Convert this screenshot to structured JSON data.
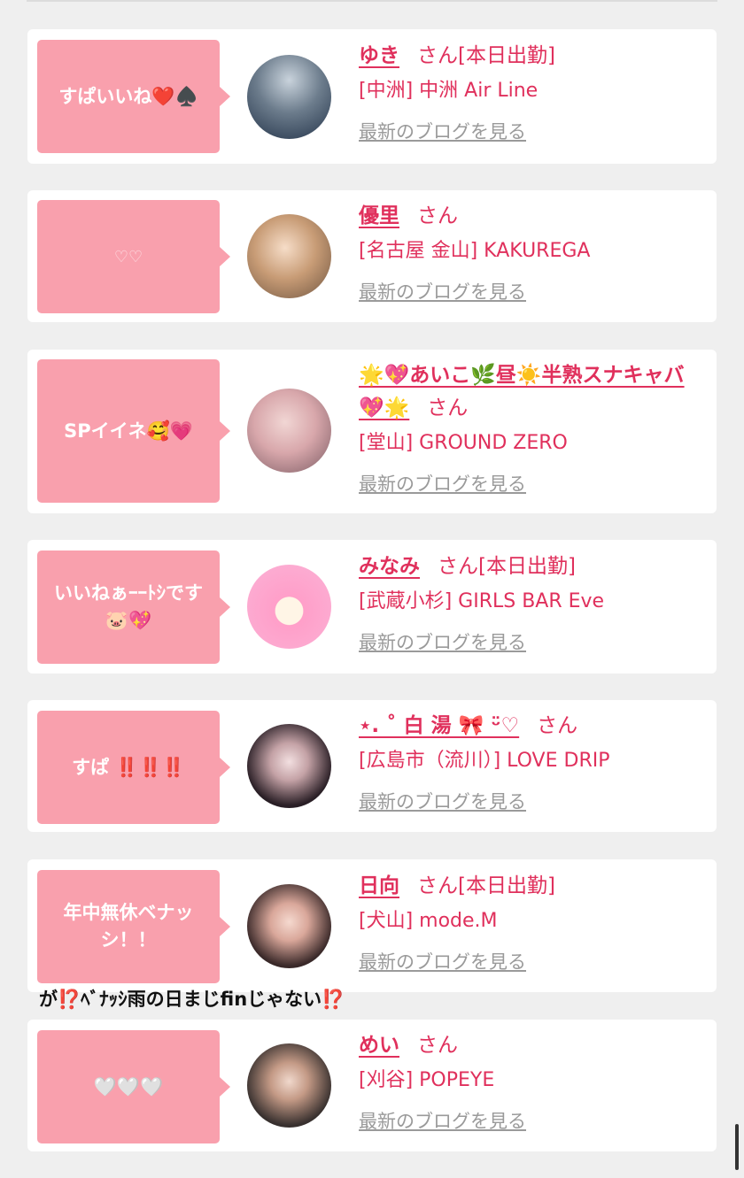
{
  "cards": [
    {
      "bubble": "すぱいいね❤️♠️",
      "name": "ゆき",
      "suffix": "さん",
      "today": "[本日出勤]",
      "shop": "[中洲] 中洲 Air Line",
      "blog": "最新のブログを見る"
    },
    {
      "bubble": "♡♡",
      "name": "優里",
      "suffix": "さん",
      "today": "",
      "shop": "[名古屋 金山] KAKUREGA",
      "blog": "最新のブログを見る"
    },
    {
      "bubble": "SPイイネ🥰💗",
      "name": "🌟💖あいこ🌿昼☀️半熟スナキャバ💖🌟",
      "suffix": "さん",
      "today": "",
      "shop": "[堂山] GROUND ZERO",
      "blog": "最新のブログを見る"
    },
    {
      "bubble": "いいねぁｰｰﾄｼです🐷💖",
      "name": "みなみ",
      "suffix": "さん",
      "today": "[本日出勤]",
      "shop": "[武蔵小杉] GIRLS BAR Eve",
      "blog": "最新のブログを見る"
    },
    {
      "bubble": "すぱ ‼️‼️‼️",
      "name": "⋆. ˚ 白 湯 🎀 ᵕ̈♡",
      "suffix": "さん",
      "today": "",
      "shop": "[広島市（流川）] LOVE DRIP",
      "blog": "最新のブログを見る"
    },
    {
      "bubble": "年中無休ベナッシ！！",
      "name": "日向",
      "suffix": "さん",
      "today": "[本日出勤]",
      "shop": "[犬山] mode.M",
      "blog": "最新のブログを見る"
    },
    {
      "bubble": "🤍🤍🤍",
      "name": "めい",
      "suffix": "さん",
      "today": "",
      "shop": "[刈谷] POPEYE",
      "blog": "最新のブログを見る"
    }
  ],
  "overflow_text": "が⁉️ﾍﾞﾅｯｼ雨の日まじfinじゃない⁉️"
}
